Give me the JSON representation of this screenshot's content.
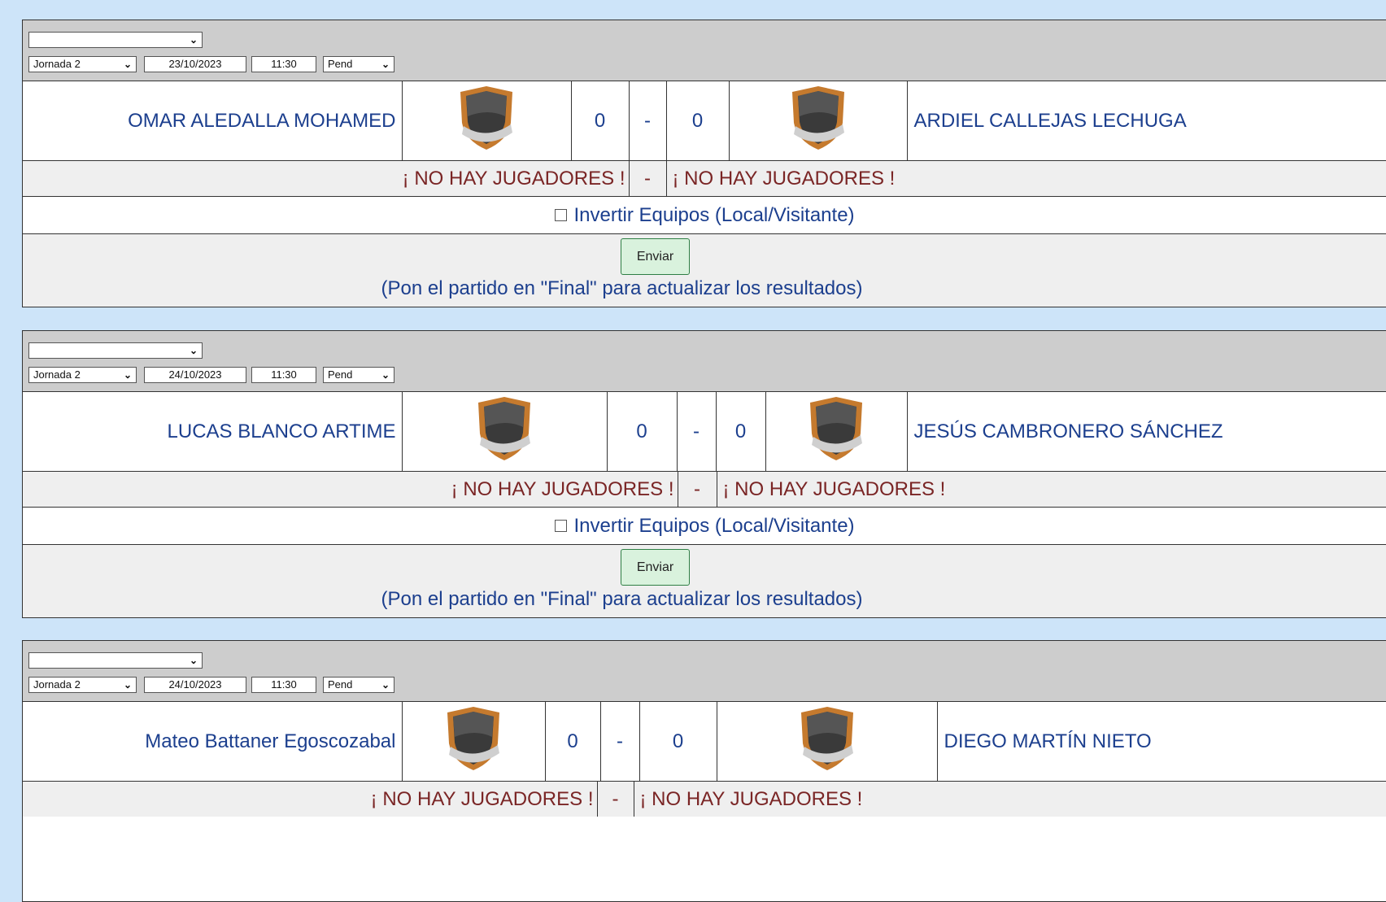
{
  "matches": [
    {
      "top_select": "",
      "jornada": "Jornada 2",
      "date": "23/10/2023",
      "time": "11:30",
      "status": "Pend",
      "home_team": "OMAR ALEDALLA MOHAMED",
      "away_team": "ARDIEL CALLEJAS LECHUGA",
      "home_score": "0",
      "separator": "-",
      "away_score": "0",
      "home_players": "¡ NO HAY JUGADORES !",
      "away_players": "¡ NO HAY JUGADORES !",
      "invert_label": "Invertir Equipos (Local/Visitante)",
      "submit_label": "Enviar",
      "note": "(Pon el partido en \"Final\" para actualizar los resultados)"
    },
    {
      "top_select": "",
      "jornada": "Jornada 2",
      "date": "24/10/2023",
      "time": "11:30",
      "status": "Pend",
      "home_team": "LUCAS BLANCO ARTIME",
      "away_team": "JESÚS CAMBRONERO SÁNCHEZ",
      "home_score": "0",
      "separator": "-",
      "away_score": "0",
      "home_players": "¡ NO HAY JUGADORES !",
      "away_players": "¡ NO HAY JUGADORES !",
      "invert_label": "Invertir Equipos (Local/Visitante)",
      "submit_label": "Enviar",
      "note": "(Pon el partido en \"Final\" para actualizar los resultados)"
    },
    {
      "top_select": "",
      "jornada": "Jornada 2",
      "date": "24/10/2023",
      "time": "11:30",
      "status": "Pend",
      "home_team": "Mateo Battaner Egoscozabal",
      "away_team": "DIEGO MARTÍN NIETO",
      "home_score": "0",
      "separator": "-",
      "away_score": "0",
      "home_players": "¡ NO HAY JUGADORES !",
      "away_players": "¡ NO HAY JUGADORES !"
    }
  ],
  "icons": {
    "select_arrow": "chevron-down-icon",
    "team_logo": "shield-icon"
  },
  "colors": {
    "page_bg": "#cde4f9",
    "header_bg": "#cdcdcd",
    "text_blue": "#1c3f8e",
    "text_red": "#7a2525",
    "button_bg": "#d9f2dd"
  }
}
